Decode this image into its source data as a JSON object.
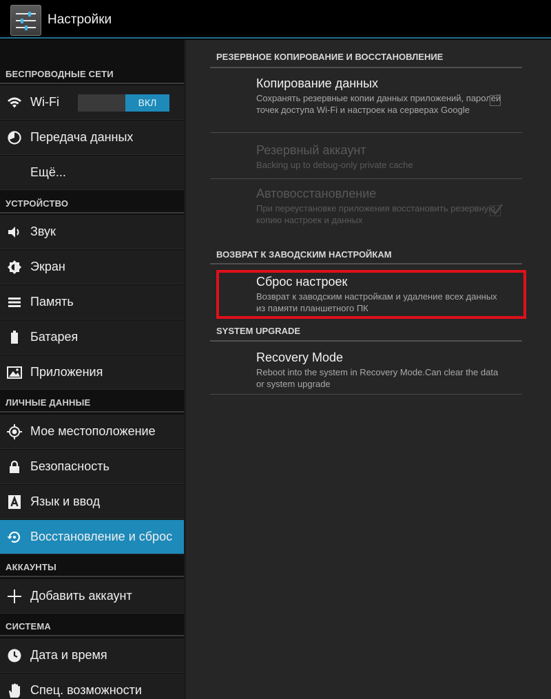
{
  "actionbar": {
    "title": "Настройки",
    "icon": "settings-sliders-icon"
  },
  "sidebar": {
    "sections": [
      {
        "header": "БЕСПРОВОДНЫЕ СЕТИ"
      },
      {
        "header": "УСТРОЙСТВО"
      },
      {
        "header": "ЛИЧНЫЕ ДАННЫЕ"
      },
      {
        "header": "АККАУНТЫ"
      },
      {
        "header": "СИСТЕМА"
      }
    ],
    "items": [
      {
        "label": "Wi-Fi",
        "icon": "wifi-icon",
        "toggle": "ВКЛ"
      },
      {
        "label": "Передача данных",
        "icon": "data-usage-icon"
      },
      {
        "label": "Ещё..."
      },
      {
        "label": "Звук",
        "icon": "speaker-icon"
      },
      {
        "label": "Экран",
        "icon": "brightness-icon"
      },
      {
        "label": "Память",
        "icon": "storage-icon"
      },
      {
        "label": "Батарея",
        "icon": "battery-icon"
      },
      {
        "label": "Приложения",
        "icon": "apps-icon"
      },
      {
        "label": "Мое местоположение",
        "icon": "location-icon"
      },
      {
        "label": "Безопасность",
        "icon": "lock-icon"
      },
      {
        "label": "Язык и ввод",
        "icon": "language-icon"
      },
      {
        "label": "Восстановление и сброс",
        "icon": "backup-restore-icon",
        "selected": true
      },
      {
        "label": "Добавить аккаунт",
        "icon": "plus-icon"
      },
      {
        "label": "Дата и время",
        "icon": "clock-icon"
      },
      {
        "label": "Спец. возможности",
        "icon": "hand-icon"
      }
    ]
  },
  "main": {
    "headers": {
      "backup": "РЕЗЕРВНОЕ КОПИРОВАНИЕ И ВОССТАНОВЛЕНИЕ",
      "factory": "ВОЗВРАТ К ЗАВОДСКИМ НАСТРОЙКАМ",
      "upgrade": "SYSTEM UPGRADE"
    },
    "prefs": {
      "backup_data": {
        "title": "Копирование данных",
        "summary": "Сохранять резервные копии данных приложений, паролей точек доступа Wi-Fi и настроек на серверах Google",
        "checked": false
      },
      "backup_account": {
        "title": "Резервный аккаунт",
        "summary": "Backing up to debug-only private cache",
        "enabled": false
      },
      "auto_restore": {
        "title": "Автовосстановление",
        "summary": "При переустановке приложения восстановить резервную копию настроек и данных",
        "checked": true,
        "enabled": false
      },
      "factory_reset": {
        "title": "Сброс настроек",
        "summary": "Возврат к заводским настройкам и удаление всех данных из памяти планшетного ПК"
      },
      "recovery_mode": {
        "title": "Recovery Mode",
        "summary": "Reboot into the system in Recovery Mode.Can clear the data or system upgrade"
      }
    },
    "highlight_color": "#e0101a"
  },
  "colors": {
    "accent": "#1d8ab9"
  }
}
